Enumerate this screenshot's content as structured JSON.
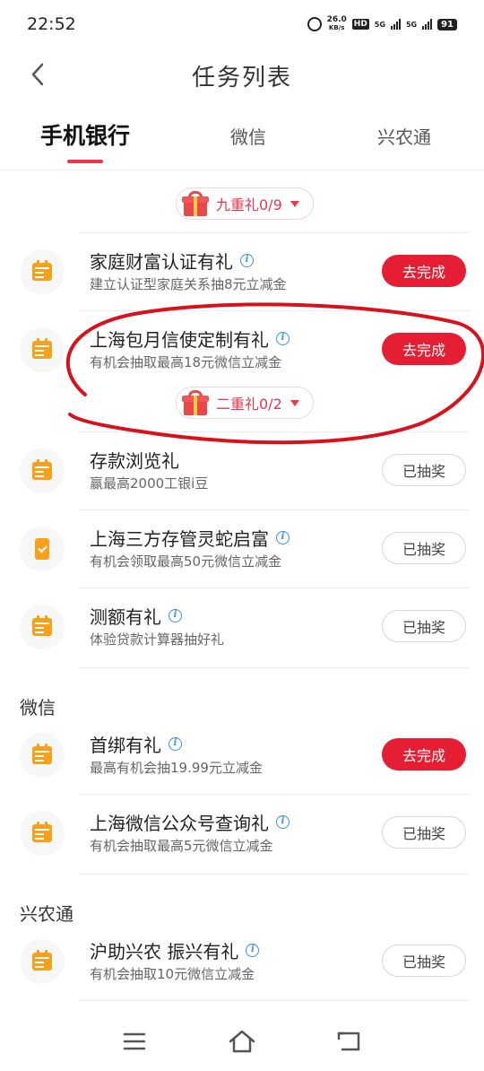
{
  "status": {
    "time": "22:52",
    "speed_value": "26.0",
    "speed_unit": "KB/s",
    "hd": "HD",
    "net1": "5G",
    "net2": "5G",
    "battery": "91"
  },
  "header": {
    "title": "任务列表"
  },
  "tabs": [
    {
      "label": "手机银行",
      "active": true
    },
    {
      "label": "微信",
      "active": false
    },
    {
      "label": "兴农通",
      "active": false
    }
  ],
  "gift_badges": [
    {
      "text": "九重礼0/9"
    },
    {
      "text": "二重礼0/2"
    }
  ],
  "sections": [
    {
      "label": "微信"
    },
    {
      "label": "兴农通"
    }
  ],
  "tasks": [
    {
      "icon": "calendar-icon",
      "title": "家庭财富认证有礼",
      "has_info": true,
      "desc": "建立认证型家庭关系抽8元立减金",
      "button": "去完成",
      "button_state": "todo"
    },
    {
      "icon": "calendar-icon",
      "title": "上海包月信使定制有礼",
      "has_info": true,
      "desc": "有机会抽取最高18元微信立减金",
      "button": "去完成",
      "button_state": "todo"
    },
    {
      "icon": "calendar-icon",
      "title": "存款浏览礼",
      "has_info": false,
      "desc": "赢最高2000工银i豆",
      "button": "已抽奖",
      "button_state": "done"
    },
    {
      "icon": "phone-check-icon",
      "title": "上海三方存管灵蛇启富",
      "has_info": true,
      "desc": "有机会领取最高50元微信立减金",
      "button": "已抽奖",
      "button_state": "done"
    },
    {
      "icon": "calendar-icon",
      "title": "测额有礼",
      "has_info": true,
      "desc": "体验贷款计算器抽好礼",
      "button": "已抽奖",
      "button_state": "done"
    },
    {
      "icon": "calendar-icon",
      "title": "首绑有礼",
      "has_info": true,
      "desc": "最高有机会抽19.99元立减金",
      "button": "去完成",
      "button_state": "todo"
    },
    {
      "icon": "calendar-icon",
      "title": "上海微信公众号查询礼",
      "has_info": true,
      "desc": "有机会抽取最高5元微信立减金",
      "button": "已抽奖",
      "button_state": "done"
    },
    {
      "icon": "calendar-icon",
      "title": "沪助兴农 振兴有礼",
      "has_info": true,
      "desc": "有机会抽取10元微信立减金",
      "button": "已抽奖",
      "button_state": "done"
    }
  ],
  "colors": {
    "accent": "#e61e33",
    "icon": "#f7a11a",
    "info": "#3a8ee6"
  }
}
